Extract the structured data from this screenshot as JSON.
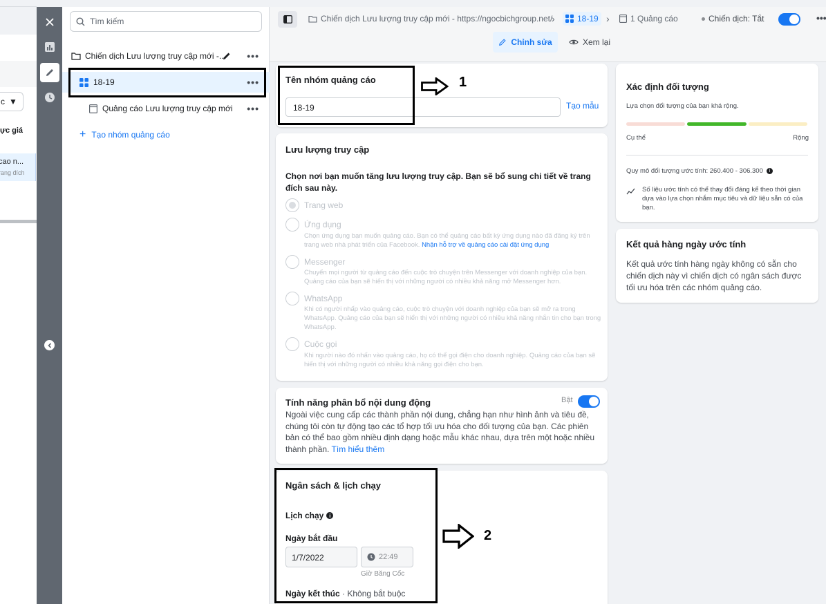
{
  "bg": {
    "dropdown_glyph": "c",
    "text1": "ực giá",
    "sel_l1": "cao n...",
    "sel_l2": "rang đích"
  },
  "tree": {
    "search_placeholder": "Tìm kiếm",
    "campaign": "Chiến dịch Lưu lượng truy cập mới -...",
    "adset": "18-19",
    "ad": "Quảng cáo Lưu lượng truy cập mới",
    "create_adset": "Tạo nhóm quảng cáo"
  },
  "header": {
    "campaign_crumb": "Chiến dịch Lưu lượng truy cập mới - https://ngocbichgroup.net/",
    "adset_crumb": "18-19",
    "ads_crumb": "1 Quảng cáo",
    "status": "Chiến dịch: Tắt",
    "edit": "Chỉnh sửa",
    "review": "Xem lại"
  },
  "name_card": {
    "title": "Tên nhóm quảng cáo",
    "value": "18-19",
    "template": "Tạo mẫu"
  },
  "traffic": {
    "title": "Lưu lượng truy cập",
    "intro": "Chọn nơi bạn muốn tăng lưu lượng truy cập. Bạn sẽ bổ sung chi tiết về trang đích sau này.",
    "options": [
      {
        "label": "Trang web",
        "desc": ""
      },
      {
        "label": "Ứng dụng",
        "desc": "Chọn ứng dụng bạn muốn quảng cáo. Bạn có thể quảng cáo bất kỳ ứng dụng nào đã đăng ký trên trang web nhà phát triển của Facebook.",
        "link": "Nhận hỗ trợ về quảng cáo cài đặt ứng dụng"
      },
      {
        "label": "Messenger",
        "desc": "Chuyển mọi người từ quảng cáo đến cuộc trò chuyện trên Messenger với doanh nghiệp của bạn. Quảng cáo của bạn sẽ hiển thị với những người có nhiều khả năng mở Messenger hơn."
      },
      {
        "label": "WhatsApp",
        "desc": "Khi có người nhấp vào quảng cáo, cuộc trò chuyện với doanh nghiệp của bạn sẽ mở ra trong WhatsApp. Quảng cáo của bạn sẽ hiển thị với những người có nhiều khả năng nhắn tin cho bạn trong WhatsApp."
      },
      {
        "label": "Cuộc gọi",
        "desc": "Khi người nào đó nhấn vào quảng cáo, họ có thể gọi điện cho doanh nghiệp. Quảng cáo của bạn sẽ hiển thị với những người có nhiều khả năng gọi điện cho bạn."
      }
    ]
  },
  "dynamic": {
    "title": "Tính năng phân bổ nội dung động",
    "toggle_label": "Bật",
    "body": "Ngoài việc cung cấp các thành phần nội dung, chẳng hạn như hình ảnh và tiêu đề, chúng tôi còn tự động tạo các tổ hợp tối ưu hóa cho đối tượng của bạn. Các phiên bản có thể bao gồm nhiều định dạng hoặc mẫu khác nhau, dựa trên một hoặc nhiều thành phần.",
    "link": "Tìm hiểu thêm"
  },
  "budget": {
    "title": "Ngân sách & lịch chạy",
    "schedule": "Lịch chạy",
    "start_label": "Ngày bắt đầu",
    "start_date": "1/7/2022",
    "start_time": "22:49",
    "timezone": "Giờ Băng Cốc",
    "end_label": "Ngày kết thúc",
    "end_optional": "· Không bắt buộc"
  },
  "audience": {
    "title": "Xác định đối tượng",
    "subtitle": "Lựa chọn đối tượng của bạn khá rộng.",
    "left": "Cụ thể",
    "right": "Rộng",
    "size": "Quy mô đối tượng ước tính: 260.400 - 306.300",
    "note": "Số liệu ước tính có thể thay đổi đáng kể theo thời gian dựa vào lựa chọn nhắm mục tiêu và dữ liệu sẵn có của bạn."
  },
  "daily": {
    "title": "Kết quả hàng ngày ước tính",
    "body": "Kết quả ước tính hàng ngày không có sẵn cho chiến dịch này vì chiến dịch có ngân sách được tối ưu hóa trên các nhóm quảng cáo."
  },
  "annotations": {
    "one": "1",
    "two": "2"
  }
}
